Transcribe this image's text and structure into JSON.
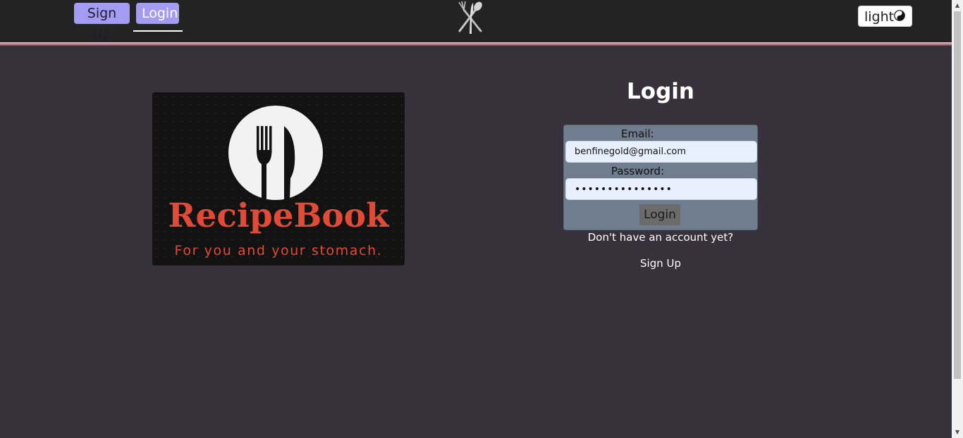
{
  "nav": {
    "signup_label": "Sign Up",
    "login_label": "Login",
    "theme_label": "light",
    "logo_icon": "fork-spoon-knife-icon",
    "theme_icon": "yin-yang-icon"
  },
  "banner": {
    "title": "RecipeBook",
    "tagline": "For you and your stomach.",
    "icon": "plate-fork-knife-icon"
  },
  "login": {
    "title": "Login",
    "email_label": "Email:",
    "email_value": "benfinegold@gmail.com",
    "password_label": "Password:",
    "password_value": "•••••••••••••••",
    "submit_label": "Login",
    "no_account_text": "Don't have an account yet?",
    "signup_link": "Sign Up"
  },
  "colors": {
    "background": "#36313a",
    "header": "#232323",
    "nav_button": "#a49cf2",
    "form_panel": "#6f7d8f",
    "brand_red": "#e04b37"
  }
}
